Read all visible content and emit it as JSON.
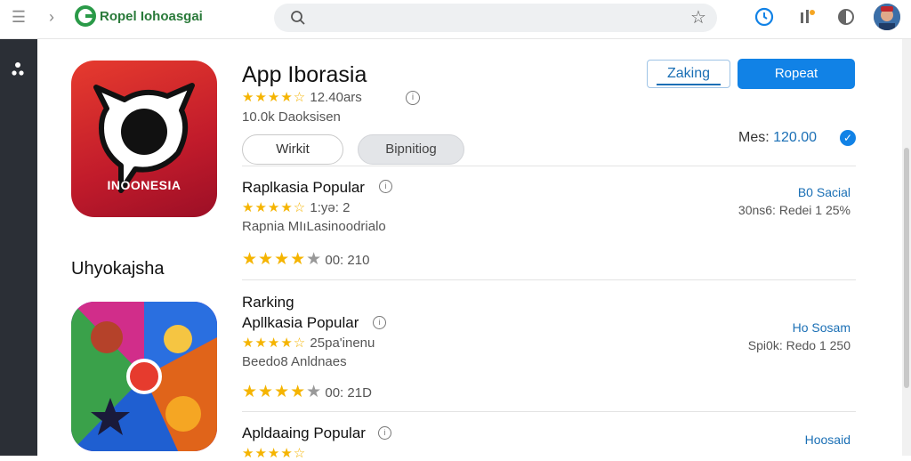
{
  "topbar": {
    "brand": "Ropel Iohoasgai",
    "search_placeholder": "",
    "icons": [
      "menu-icon",
      "chevron-right-icon",
      "search-icon",
      "star-icon",
      "clock-icon",
      "download-icon",
      "theme-icon"
    ]
  },
  "rail": {
    "glyph": "• •"
  },
  "app": {
    "title": "App Iborasia",
    "stars": "★★★★☆",
    "rating_text": "12.40ars",
    "downloads": "10.0k Daoksisen",
    "icon_label": "INOONESIA",
    "wishlist_label": "Wirkit",
    "description_label": "Bipnitiog",
    "ranking_button": "Zaking",
    "report_button": "Ropeat",
    "meta_label": "Mes:",
    "meta_value": "120.00"
  },
  "section_title": "Uhyokajsha",
  "ranking_heading": "Rarking",
  "list": [
    {
      "title": "Raplkasia Popular",
      "stars": "★★★★☆",
      "sub": "1:yə: 2",
      "desc": "Rapnia  MIıLasinoodrialo",
      "rating_stars": "★★★★",
      "rating_gray": "★",
      "rating_value": "00: 210",
      "tag": "B0 Sacial",
      "tag_sub": "30ns6: Redei 1 25%"
    },
    {
      "title": "Apllkasia Popular",
      "stars": "★★★★☆",
      "sub": "25pa'inenu",
      "desc": "Beedo8  Anldnaes",
      "rating_stars": "★★★★",
      "rating_gray": "★",
      "rating_value": "00: 21D",
      "tag": "Ho Sosam",
      "tag_sub": "Spi0k: Redo 1 250"
    },
    {
      "title": "Apldaaing Popular",
      "stars": "★★★★☆",
      "sub": "",
      "desc": "",
      "rating_stars": "",
      "rating_gray": "",
      "rating_value": "",
      "tag": "Hoosaid",
      "tag_sub": ""
    }
  ],
  "colors": {
    "accent": "#1182e6",
    "star": "#f5b400",
    "brand": "#2a7a3a",
    "rail": "#2b2f36"
  }
}
